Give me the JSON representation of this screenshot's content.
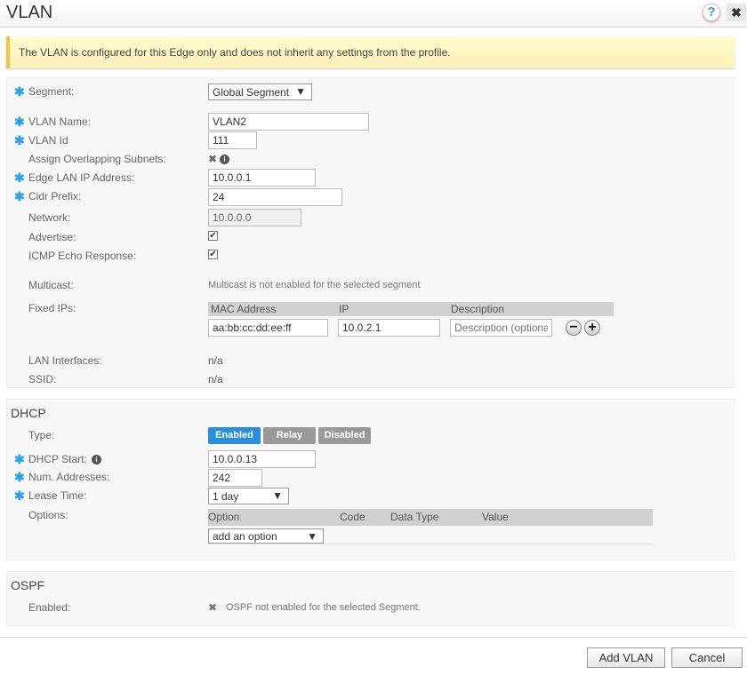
{
  "header": {
    "title": "VLAN",
    "help_icon": "?",
    "close_icon": "✖"
  },
  "banner": "The VLAN is configured for this Edge only and does not inherit any settings from the profile.",
  "vlan": {
    "segment_label": "Segment:",
    "segment_value": "Global Segment",
    "name_label": "VLAN Name:",
    "name_value": "VLAN2",
    "id_label": "VLAN Id",
    "id_value": "111",
    "overlap_label": "Assign Overlapping Subnets:",
    "edge_ip_label": "Edge LAN IP Address:",
    "edge_ip_value": "10.0.0.1",
    "cidr_label": "Cidr Prefix:",
    "cidr_value": "24",
    "network_label": "Network:",
    "network_value": "10.0.0.0",
    "advertise_label": "Advertise:",
    "advertise_checked": true,
    "icmp_label": "ICMP Echo Response:",
    "icmp_checked": true,
    "multicast_label": "Multicast:",
    "multicast_value": "Multicast is not enabled for the selected segment",
    "fixed_label": "Fixed IPs:",
    "fixed_columns": [
      "MAC Address",
      "IP",
      "Description"
    ],
    "fixed_row": {
      "mac": "aa:bb:cc:dd:ee:ff",
      "ip": "10.0.2.1",
      "description_placeholder": "Description (optional)"
    },
    "lan_label": "LAN Interfaces:",
    "lan_value": "n/a",
    "ssid_label": "SSID:",
    "ssid_value": "n/a"
  },
  "dhcp": {
    "title": "DHCP",
    "type_label": "Type:",
    "type_options": [
      "Enabled",
      "Relay",
      "Disabled"
    ],
    "type_selected": "Enabled",
    "start_label": "DHCP Start:",
    "start_value": "10.0.0.13",
    "num_label": "Num. Addresses:",
    "num_value": "242",
    "lease_label": "Lease Time:",
    "lease_value": "1 day",
    "options_label": "Options:",
    "options_columns": [
      "Option",
      "Code",
      "Data Type",
      "Value"
    ],
    "add_option": "add an option"
  },
  "ospf": {
    "title": "OSPF",
    "enabled_label": "Enabled:",
    "enabled_value": "OSPF not enabled for the selected Segment."
  },
  "footer": {
    "add": "Add VLAN",
    "cancel": "Cancel"
  },
  "colors": {
    "accent": "#2a8ee0",
    "required": "#29a3e6",
    "banner_border": "#f5c342"
  }
}
